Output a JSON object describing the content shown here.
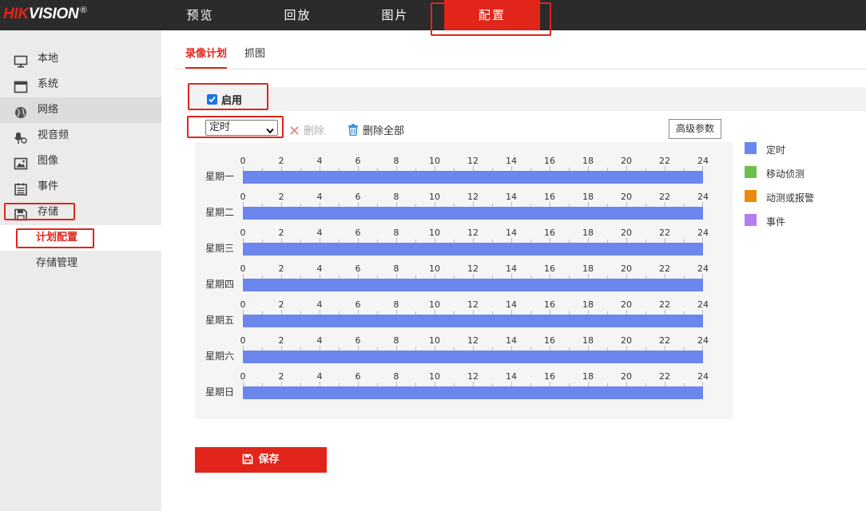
{
  "brand": {
    "prefix": "HIK",
    "suffix": "VISION",
    "reg": "®"
  },
  "nav": [
    {
      "label": "预览"
    },
    {
      "label": "回放"
    },
    {
      "label": "图片"
    },
    {
      "label": "配置"
    }
  ],
  "sidebar": {
    "items": [
      {
        "label": "本地",
        "icon": "monitor-icon"
      },
      {
        "label": "系统",
        "icon": "window-icon"
      },
      {
        "label": "网络",
        "icon": "globe-icon"
      },
      {
        "label": "视音频",
        "icon": "mic-icon"
      },
      {
        "label": "图像",
        "icon": "image-icon"
      },
      {
        "label": "事件",
        "icon": "calendar-icon"
      },
      {
        "label": "存储",
        "icon": "floppy-icon"
      }
    ],
    "sub_items": [
      {
        "label": "计划配置"
      },
      {
        "label": "存储管理"
      }
    ]
  },
  "tabs": [
    {
      "label": "录像计划"
    },
    {
      "label": "抓图"
    }
  ],
  "enable": {
    "label": "启用",
    "checked": true
  },
  "toolbar": {
    "select_value": "定时",
    "delete_label": "删除",
    "delete_all_label": "删除全部",
    "advanced_label": "高级参数"
  },
  "schedule": {
    "ticks": [
      "0",
      "2",
      "4",
      "6",
      "8",
      "10",
      "12",
      "14",
      "16",
      "18",
      "20",
      "22",
      "24"
    ],
    "days": [
      {
        "label": "星期一",
        "type": "定时",
        "start": 0,
        "end": 24
      },
      {
        "label": "星期二",
        "type": "定时",
        "start": 0,
        "end": 24
      },
      {
        "label": "星期三",
        "type": "定时",
        "start": 0,
        "end": 24
      },
      {
        "label": "星期四",
        "type": "定时",
        "start": 0,
        "end": 24
      },
      {
        "label": "星期五",
        "type": "定时",
        "start": 0,
        "end": 24
      },
      {
        "label": "星期六",
        "type": "定时",
        "start": 0,
        "end": 24
      },
      {
        "label": "星期日",
        "type": "定时",
        "start": 0,
        "end": 24
      }
    ]
  },
  "legend": [
    {
      "label": "定时",
      "color": "#6b86ec"
    },
    {
      "label": "移动侦测",
      "color": "#6cbf4f"
    },
    {
      "label": "动测或报警",
      "color": "#ea8a0c"
    },
    {
      "label": "事件",
      "color": "#b37df0"
    }
  ],
  "save": {
    "label": "保存"
  }
}
